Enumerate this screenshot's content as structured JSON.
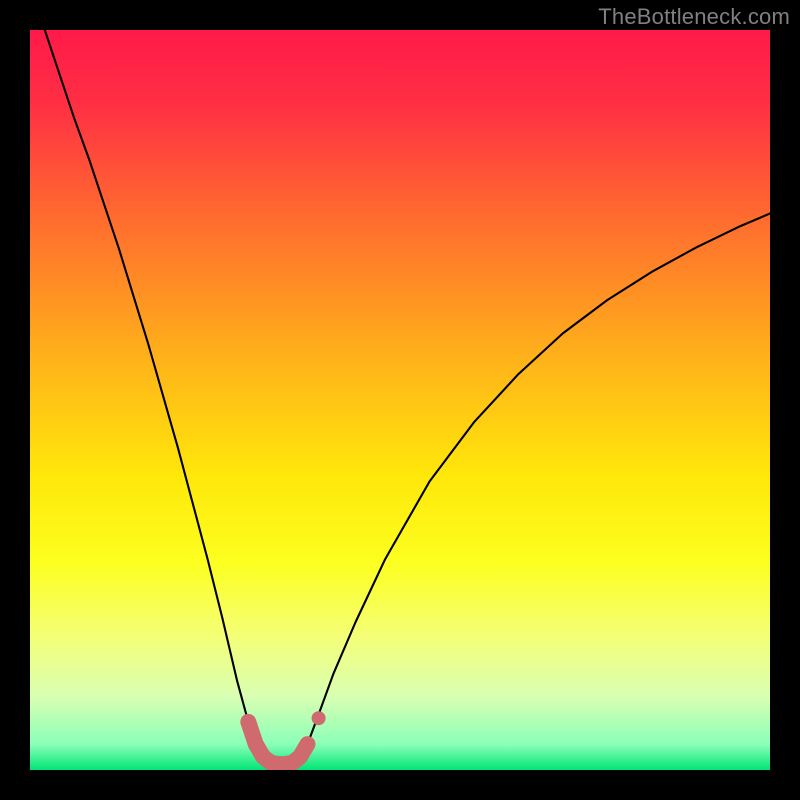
{
  "watermark": "TheBottleneck.com",
  "chart_data": {
    "type": "line",
    "title": "",
    "xlabel": "",
    "ylabel": "",
    "xlim": [
      0,
      100
    ],
    "ylim": [
      0,
      100
    ],
    "background_gradient": {
      "stops": [
        {
          "offset": 0.0,
          "color": "#ff1a49"
        },
        {
          "offset": 0.1,
          "color": "#ff2f44"
        },
        {
          "offset": 0.25,
          "color": "#ff6a2f"
        },
        {
          "offset": 0.45,
          "color": "#ffb419"
        },
        {
          "offset": 0.6,
          "color": "#ffe70a"
        },
        {
          "offset": 0.72,
          "color": "#fcff1f"
        },
        {
          "offset": 0.82,
          "color": "#f4ff77"
        },
        {
          "offset": 0.9,
          "color": "#d9ffb3"
        },
        {
          "offset": 0.965,
          "color": "#8cffb8"
        },
        {
          "offset": 1.0,
          "color": "#00e676"
        }
      ]
    },
    "series": [
      {
        "name": "bottleneck-curve",
        "stroke": "#000000",
        "stroke_width": 2.1,
        "x": [
          2,
          4,
          6,
          8,
          10,
          12,
          14,
          16,
          18,
          20,
          22,
          24,
          26,
          28,
          29.5,
          30.5,
          31.5,
          32.5,
          33.5,
          34.5,
          35.5,
          36.5,
          37.5,
          39,
          41,
          44,
          48,
          54,
          60,
          66,
          72,
          78,
          84,
          90,
          96,
          100
        ],
        "y": [
          100,
          94,
          88,
          82.5,
          76.5,
          70.5,
          64,
          57.5,
          50.5,
          43.5,
          36,
          28.5,
          20.5,
          12,
          6.5,
          3.5,
          1.8,
          1.0,
          0.8,
          0.8,
          1.0,
          1.8,
          3.5,
          7.5,
          13,
          20,
          28.5,
          39,
          47,
          53.5,
          59,
          63.5,
          67.3,
          70.6,
          73.5,
          75.2
        ]
      }
    ],
    "highlight_band": {
      "name": "optimal-zone-marker",
      "stroke": "#cf6a6f",
      "stroke_width": 16,
      "linecap": "round",
      "x": [
        29.5,
        30.5,
        31.5,
        32.5,
        33.5,
        34.5,
        35.5,
        36.5,
        37.5
      ],
      "y": [
        6.5,
        3.5,
        1.8,
        1.0,
        0.8,
        0.8,
        1.0,
        1.8,
        3.5
      ]
    },
    "highlight_dot": {
      "name": "marker-dot",
      "fill": "#cf6a6f",
      "r": 7,
      "x": 39.0,
      "y": 7.0
    }
  }
}
